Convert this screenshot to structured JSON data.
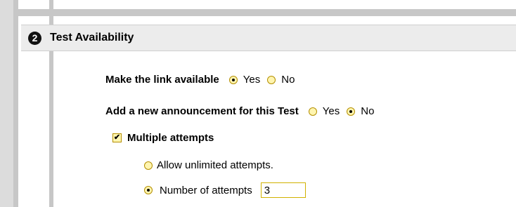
{
  "section": {
    "step_number": "2",
    "title": "Test Availability"
  },
  "form": {
    "make_available": {
      "label": "Make the link available",
      "options": [
        {
          "label": "Yes",
          "selected": true
        },
        {
          "label": "No",
          "selected": false
        }
      ]
    },
    "announcement": {
      "label": "Add a new announcement for this Test",
      "options": [
        {
          "label": "Yes",
          "selected": false
        },
        {
          "label": "No",
          "selected": true
        }
      ]
    },
    "multiple_attempts": {
      "label": "Multiple attempts",
      "checked": true,
      "unlimited_label": "Allow unlimited attempts.",
      "number_label": "Number of attempts",
      "number_value": "3",
      "selected_option": "number"
    }
  },
  "colors": {
    "header_bg": "#ececec",
    "gray_bar": "#c7c7c7",
    "control_border": "#b48f00",
    "control_fill": "#fff5b0"
  }
}
